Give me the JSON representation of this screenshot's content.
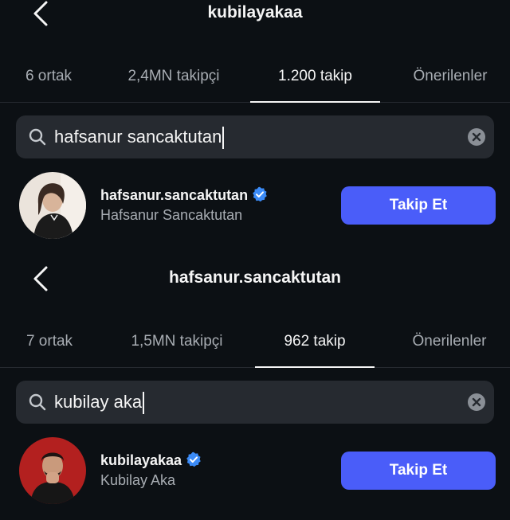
{
  "panels": [
    {
      "title": "kubilayakaa",
      "tabs": [
        {
          "label": "6 ortak"
        },
        {
          "label": "2,4MN takipçi"
        },
        {
          "label": "1.200 takip"
        },
        {
          "label": "Önerilenler"
        }
      ],
      "active_tab": "1.200 takip",
      "search": {
        "query": "hafsanur sancaktutan"
      },
      "result": {
        "username": "hafsanur.sancaktutan",
        "full_name": "Hafsanur Sancaktutan",
        "button_label": "Takip Et",
        "verified": true
      }
    },
    {
      "title": "hafsanur.sancaktutan",
      "tabs": [
        {
          "label": "7 ortak"
        },
        {
          "label": "1,5MN takipçi"
        },
        {
          "label": "962 takip"
        },
        {
          "label": "Önerilenler"
        }
      ],
      "active_tab": "962 takip",
      "search": {
        "query": "kubilay aka"
      },
      "result": {
        "username": "kubilayakaa",
        "full_name": "Kubilay Aka",
        "button_label": "Takip Et",
        "verified": true
      }
    }
  ],
  "icons": {
    "back": "chevron-left-icon",
    "search": "search-icon",
    "clear": "clear-circle-icon",
    "verified": "verified-badge-icon"
  },
  "colors": {
    "background": "#0c1014",
    "follow_button": "#4a5df9",
    "verified_badge": "#3b8bf7",
    "search_field": "#262a30"
  }
}
